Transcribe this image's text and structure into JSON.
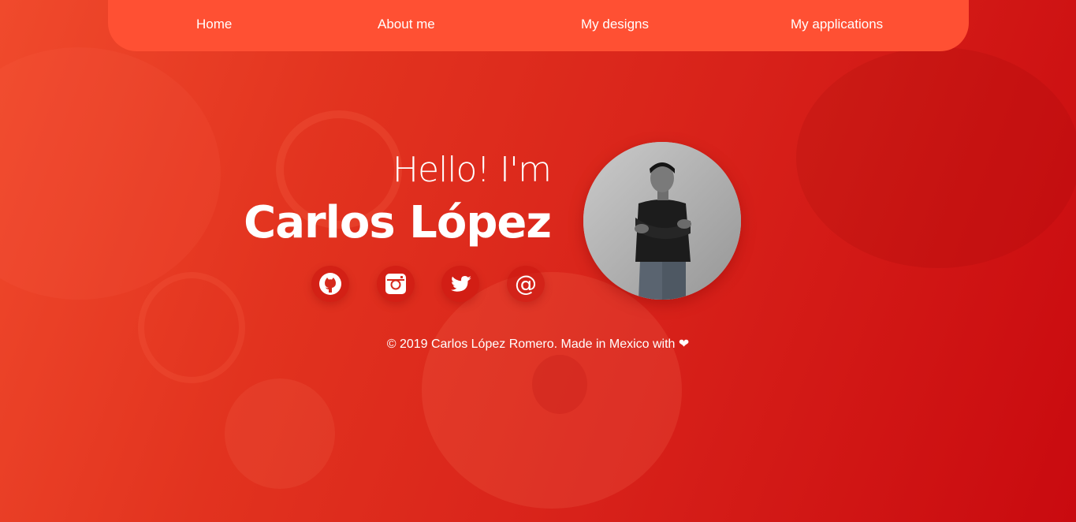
{
  "nav": {
    "items": [
      {
        "label": "Home"
      },
      {
        "label": "About me"
      },
      {
        "label": "My designs"
      },
      {
        "label": "My applications"
      }
    ]
  },
  "hero": {
    "greeting": "Hello! I'm",
    "name": "Carlos López"
  },
  "social": [
    {
      "icon": "github-icon"
    },
    {
      "icon": "instagram-icon"
    },
    {
      "icon": "twitter-icon"
    },
    {
      "icon": "at-sign-icon",
      "glyph": "@"
    }
  ],
  "footer": {
    "text": "© 2019 Carlos López Romero. Made in Mexico with ❤"
  },
  "colors": {
    "nav_background": "#ff5033",
    "page_gradient_start": "#f04a2c",
    "page_gradient_end": "#c90a0f",
    "text": "#ffffff"
  }
}
